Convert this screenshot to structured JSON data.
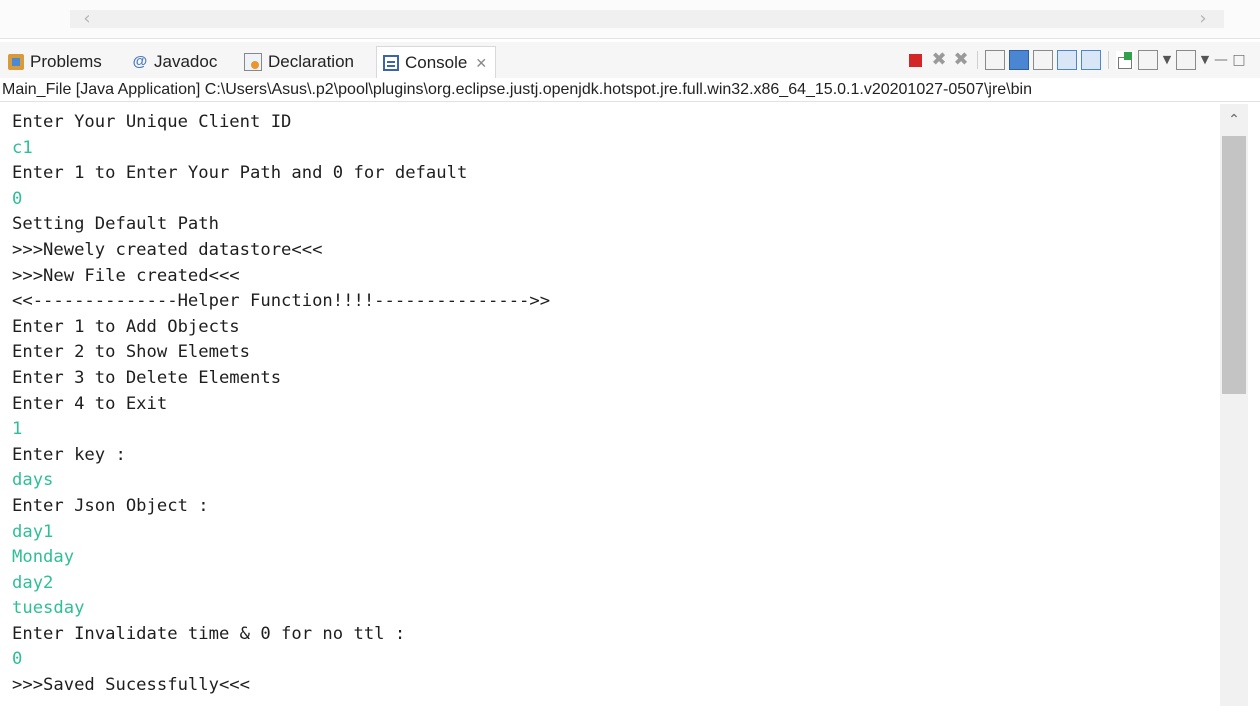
{
  "tabs": [
    {
      "label": "Problems",
      "icon": "problems-icon"
    },
    {
      "label": "Javadoc",
      "icon": "javadoc-icon"
    },
    {
      "label": "Declaration",
      "icon": "declaration-icon"
    },
    {
      "label": "Console",
      "icon": "console-icon",
      "close": "✕",
      "active": true
    }
  ],
  "launch": {
    "description": "Main_File [Java Application] C:\\Users\\Asus\\.p2\\pool\\plugins\\org.eclipse.justj.openjdk.hotspot.jre.full.win32.x86_64_15.0.1.v20201027-0507\\jre\\bin"
  },
  "colors": {
    "input_text": "#2fbf96",
    "output_text": "#1e1e1e",
    "terminate": "#d32626"
  },
  "console": {
    "lines": [
      {
        "text": "Enter Your Unique Client ID",
        "type": "output"
      },
      {
        "text": "c1",
        "type": "input"
      },
      {
        "text": "Enter 1 to Enter Your Path and 0 for default",
        "type": "output"
      },
      {
        "text": "0",
        "type": "input"
      },
      {
        "text": "Setting Default Path",
        "type": "output"
      },
      {
        "text": ">>>Newely created datastore<<<",
        "type": "output"
      },
      {
        "text": ">>>New File created<<<",
        "type": "output"
      },
      {
        "text": "<<--------------Helper Function!!!!--------------->>",
        "type": "output"
      },
      {
        "text": "Enter 1 to Add Objects",
        "type": "output"
      },
      {
        "text": "Enter 2 to Show Elemets",
        "type": "output"
      },
      {
        "text": "Enter 3 to Delete Elements",
        "type": "output"
      },
      {
        "text": "Enter 4 to Exit",
        "type": "output"
      },
      {
        "text": "1",
        "type": "input"
      },
      {
        "text": "Enter key :",
        "type": "output"
      },
      {
        "text": "days",
        "type": "input"
      },
      {
        "text": "Enter Json Object :",
        "type": "output"
      },
      {
        "text": "day1",
        "type": "input"
      },
      {
        "text": "Monday",
        "type": "input"
      },
      {
        "text": "day2",
        "type": "input"
      },
      {
        "text": "tuesday",
        "type": "input"
      },
      {
        "text": "Enter Invalidate time & 0 for no ttl :",
        "type": "output"
      },
      {
        "text": "0",
        "type": "input"
      },
      {
        "text": ">>>Saved Sucessfully<<<",
        "type": "output"
      }
    ]
  }
}
